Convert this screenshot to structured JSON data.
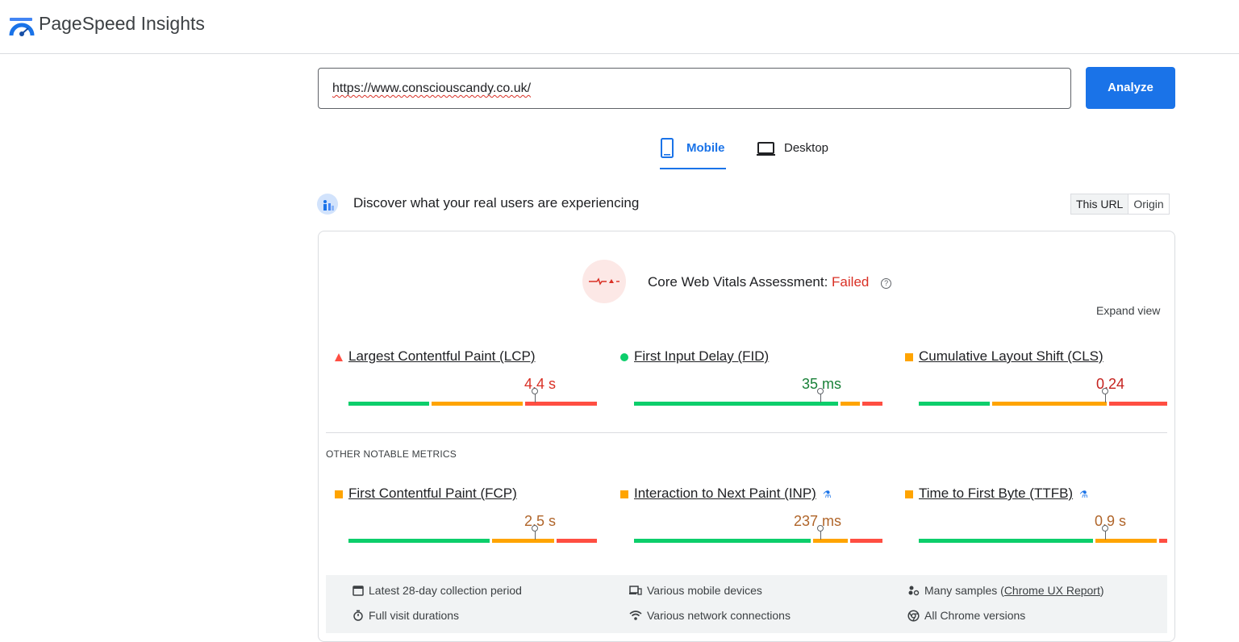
{
  "header": {
    "brand": "PageSpeed Insights"
  },
  "search": {
    "url": "https://www.consciouscandy.co.uk/",
    "analyze_label": "Analyze"
  },
  "tabs": [
    {
      "label": "Mobile",
      "active": true
    },
    {
      "label": "Desktop",
      "active": false
    }
  ],
  "field": {
    "heading": "Discover what your real users are experiencing",
    "toggle": [
      "This URL",
      "Origin"
    ]
  },
  "assessment": {
    "label": "Core Web Vitals Assessment:",
    "status": "Failed",
    "expand_label": "Expand view"
  },
  "core_metrics": [
    {
      "name": "Largest Contentful Paint (LCP)",
      "value": "4.4 s",
      "rating": "poor"
    },
    {
      "name": "First Input Delay (FID)",
      "value": "35 ms",
      "rating": "good"
    },
    {
      "name": "Cumulative Layout Shift (CLS)",
      "value": "0.24",
      "rating": "needs-improvement"
    }
  ],
  "other_heading": "OTHER NOTABLE METRICS",
  "other_metrics": [
    {
      "name": "First Contentful Paint (FCP)",
      "value": "2.5 s",
      "rating": "needs-improvement"
    },
    {
      "name": "Interaction to Next Paint (INP)",
      "value": "237 ms",
      "rating": "needs-improvement",
      "experimental": true
    },
    {
      "name": "Time to First Byte (TTFB)",
      "value": "0.9 s",
      "rating": "needs-improvement",
      "experimental": true
    }
  ],
  "footer": {
    "items": [
      "Latest 28-day collection period",
      "Various mobile devices",
      "Many samples (",
      "Full visit durations",
      "Various network connections",
      "All Chrome versions"
    ],
    "crux_link": "Chrome UX Report",
    "crux_close": ")"
  },
  "colors": {
    "accent": "#1a73e8",
    "good": "#0cce6b",
    "average": "#ffa400",
    "poor": "#ff4e42"
  }
}
